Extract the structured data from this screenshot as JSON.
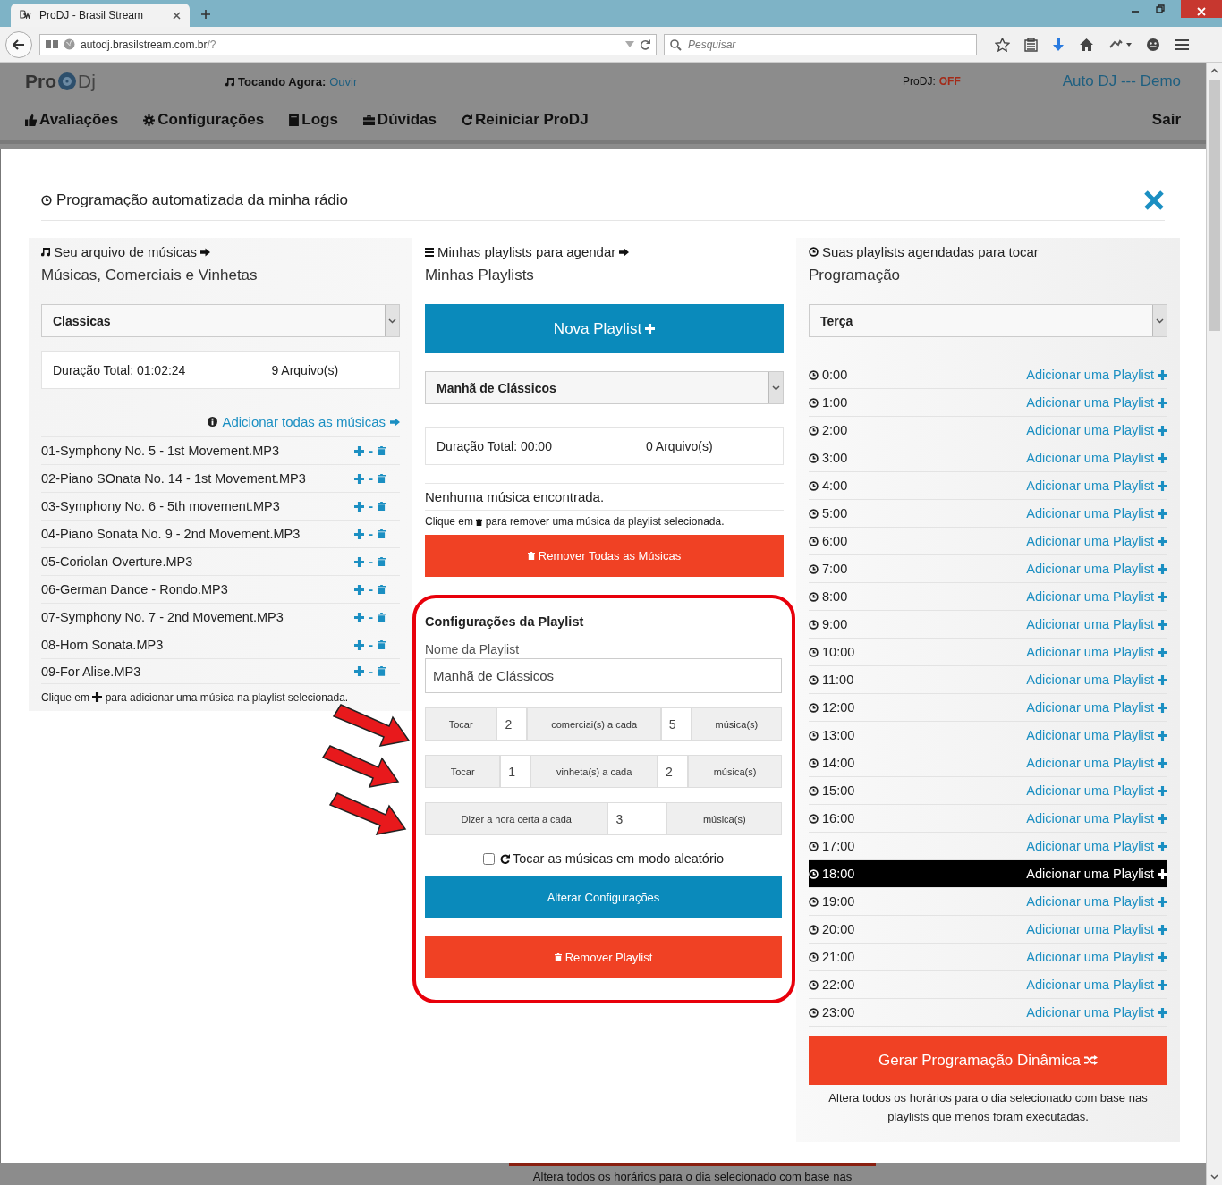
{
  "browser": {
    "tab_title": "ProDJ - Brasil Stream",
    "url_host": "autodj.brasilstream.com.br",
    "url_path": "/?",
    "search_placeholder": "Pesquisar"
  },
  "header": {
    "logo_left": "Pro",
    "logo_right": "Dj",
    "now_playing_label": "Tocando Agora:",
    "now_playing_link": "Ouvir",
    "status_label": "ProDJ:",
    "status_value": "OFF",
    "brand": "Auto DJ --- Demo",
    "nav": [
      {
        "kind": "thumb",
        "label": "Avaliações"
      },
      {
        "kind": "gear",
        "label": "Configurações"
      },
      {
        "kind": "book",
        "label": "Logs"
      },
      {
        "kind": "briefcase",
        "label": "Dúvidas"
      },
      {
        "kind": "refresh",
        "label": "Reiniciar ProDJ"
      }
    ],
    "logout": "Sair"
  },
  "modal": {
    "title": "Programação automatizada da minha rádio",
    "library": {
      "caption": "Seu arquivo de músicas",
      "heading": "Músicas, Comerciais e Vinhetas",
      "folder": "Classicas",
      "duration": "Duração Total: 01:02:24",
      "count": "9 Arquivo(s)",
      "add_all": "Adicionar todas as músicas",
      "songs": [
        {
          "name": "01-Symphony No. 5 - 1st Movement.MP3",
          "separator": "-"
        },
        {
          "name": "02-Piano SOnata No. 14 - 1st Movement.MP3",
          "separator": "-"
        },
        {
          "name": "03-Symphony No. 6 - 5th movement.MP3",
          "separator": "-"
        },
        {
          "name": "04-Piano Sonata No. 9 - 2nd Movement.MP3",
          "separator": "-"
        },
        {
          "name": "05-Coriolan Overture.MP3",
          "separator": "-"
        },
        {
          "name": "06-German Dance - Rondo.MP3",
          "separator": "-"
        },
        {
          "name": "07-Symphony No. 7 - 2nd Movement.MP3",
          "separator": "-"
        },
        {
          "name": "08-Horn Sonata.MP3",
          "separator": "-"
        },
        {
          "name": "09-For Alise.MP3",
          "separator": "-"
        }
      ],
      "hint_before": "Clique em",
      "hint_after": "para adicionar uma música na playlist selecionada."
    },
    "playlists": {
      "caption": "Minhas playlists para agendar",
      "heading": "Minhas Playlists",
      "new_button": "Nova Playlist",
      "selected_playlist": "Manhã de Clássicos",
      "duration": "Duração Total: 00:00",
      "count": "0 Arquivo(s)",
      "empty": "Nenhuma música encontrada.",
      "hint_before": "Clique em",
      "hint_after": "para remover uma música da playlist selecionada.",
      "remove_all": "Remover Todas as Músicas",
      "settings": {
        "title": "Configurações da Playlist",
        "name_label": "Nome da Playlist",
        "name_value": "Manhã de Clássicos",
        "rules": [
          [
            {
              "kind": "label",
              "text": "Tocar"
            },
            {
              "kind": "input",
              "text": "2"
            },
            {
              "kind": "label",
              "text": "comerciai(s) a cada"
            },
            {
              "kind": "input",
              "text": "5"
            },
            {
              "kind": "label",
              "text": "música(s)"
            }
          ],
          [
            {
              "kind": "label",
              "text": "Tocar"
            },
            {
              "kind": "input",
              "text": "1"
            },
            {
              "kind": "label",
              "text": "vinheta(s) a cada"
            },
            {
              "kind": "input",
              "text": "2"
            },
            {
              "kind": "label",
              "text": "música(s)"
            }
          ],
          [
            {
              "kind": "label",
              "text": "Dizer a hora certa a cada"
            },
            {
              "kind": "input",
              "text": "3"
            },
            {
              "kind": "label",
              "text": "música(s)"
            }
          ]
        ],
        "shuffle": {
          "label": "Tocar as músicas em modo aleatório",
          "checked": false
        },
        "save_button": "Alterar Configurações",
        "remove_button": "Remover Playlist"
      }
    },
    "schedule": {
      "caption": "Suas playlists agendadas para tocar",
      "heading": "Programação",
      "day": "Terça",
      "slots": [
        {
          "time": "0:00",
          "action": "Adicionar uma Playlist",
          "selected": false
        },
        {
          "time": "1:00",
          "action": "Adicionar uma Playlist",
          "selected": false
        },
        {
          "time": "2:00",
          "action": "Adicionar uma Playlist",
          "selected": false
        },
        {
          "time": "3:00",
          "action": "Adicionar uma Playlist",
          "selected": false
        },
        {
          "time": "4:00",
          "action": "Adicionar uma Playlist",
          "selected": false
        },
        {
          "time": "5:00",
          "action": "Adicionar uma Playlist",
          "selected": false
        },
        {
          "time": "6:00",
          "action": "Adicionar uma Playlist",
          "selected": false
        },
        {
          "time": "7:00",
          "action": "Adicionar uma Playlist",
          "selected": false
        },
        {
          "time": "8:00",
          "action": "Adicionar uma Playlist",
          "selected": false
        },
        {
          "time": "9:00",
          "action": "Adicionar uma Playlist",
          "selected": false
        },
        {
          "time": "10:00",
          "action": "Adicionar uma Playlist",
          "selected": false
        },
        {
          "time": "11:00",
          "action": "Adicionar uma Playlist",
          "selected": false
        },
        {
          "time": "12:00",
          "action": "Adicionar uma Playlist",
          "selected": false
        },
        {
          "time": "13:00",
          "action": "Adicionar uma Playlist",
          "selected": false
        },
        {
          "time": "14:00",
          "action": "Adicionar uma Playlist",
          "selected": false
        },
        {
          "time": "15:00",
          "action": "Adicionar uma Playlist",
          "selected": false
        },
        {
          "time": "16:00",
          "action": "Adicionar uma Playlist",
          "selected": false
        },
        {
          "time": "17:00",
          "action": "Adicionar uma Playlist",
          "selected": false
        },
        {
          "time": "18:00",
          "action": "Adicionar uma Playlist",
          "selected": true
        },
        {
          "time": "19:00",
          "action": "Adicionar uma Playlist",
          "selected": false
        },
        {
          "time": "20:00",
          "action": "Adicionar uma Playlist",
          "selected": false
        },
        {
          "time": "21:00",
          "action": "Adicionar uma Playlist",
          "selected": false
        },
        {
          "time": "22:00",
          "action": "Adicionar uma Playlist",
          "selected": false
        },
        {
          "time": "23:00",
          "action": "Adicionar uma Playlist",
          "selected": false
        }
      ],
      "generate_button": "Gerar Programação Dinâmica",
      "generate_note": "Altera todos os horários para o dia selecionado com base nas playlists que menos foram executadas."
    }
  },
  "background_note": "Altera todos os horários para o dia selecionado com base nas"
}
